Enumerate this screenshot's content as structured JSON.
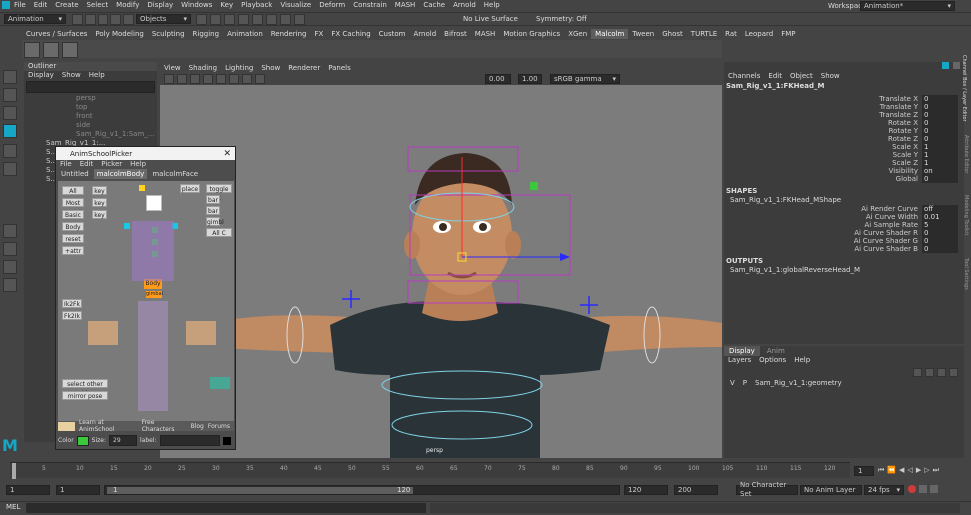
{
  "menu": {
    "items": [
      "File",
      "Edit",
      "Create",
      "Select",
      "Modify",
      "Display",
      "Windows",
      "Key",
      "Playback",
      "Visualize",
      "Deform",
      "Constrain",
      "MASH",
      "Cache",
      "Arnold",
      "Help"
    ],
    "workspace_label": "Workspace :",
    "workspace_value": "Animation*"
  },
  "status_line": {
    "mode": "Animation",
    "objects_label": "Objects",
    "live_surface": "No Live Surface",
    "symmetry": "Symmetry: Off"
  },
  "shelf_tabs": [
    "Curves / Surfaces",
    "Poly Modeling",
    "Sculpting",
    "Rigging",
    "Animation",
    "Rendering",
    "FX",
    "FX Caching",
    "Custom",
    "Arnold",
    "Bifrost",
    "MASH",
    "Motion Graphics",
    "XGen",
    "Malcolm",
    "Tween",
    "Ghost",
    "TURTLE",
    "Rat",
    "Leopard",
    "FMP"
  ],
  "shelf_active": "Malcolm",
  "outliner": {
    "title": "Outliner",
    "menus": [
      "Display",
      "Show",
      "Help"
    ],
    "items": [
      "persp",
      "top",
      "front",
      "side",
      "Sam_Rig_v1_1:Sam_...",
      "Sam_Rig_v1_1:...",
      "S...",
      "S...",
      "S...",
      "S..."
    ]
  },
  "viewport": {
    "menus": [
      "View",
      "Shading",
      "Lighting",
      "Show",
      "Renderer",
      "Panels"
    ],
    "field1": "0.00",
    "field2": "1.00",
    "colorspace": "sRGB gamma",
    "camera_label": "persp"
  },
  "picker": {
    "title": "AnimSchoolPicker",
    "menus": [
      "File",
      "Edit",
      "Picker",
      "Help"
    ],
    "tabs": [
      "Untitled",
      "malcolmBody",
      "malcolmFace"
    ],
    "active_tab": "malcolmBody",
    "left_buttons": [
      "All",
      "Most",
      "Basic",
      "Body",
      "reset",
      "+attr"
    ],
    "key_buttons": [
      "key",
      "key",
      "key"
    ],
    "right_buttons": [
      "place",
      "toggle C",
      "bar",
      "bar",
      "gimbl",
      "All C"
    ],
    "body_label": "Body",
    "gimbal_label": "gimbal",
    "ik_labels": [
      "Ik2Fk",
      "Fk2Ik"
    ],
    "select_other": "select other side",
    "mirror_pose": "mirror pose",
    "footer_links": [
      "Learn at AnimSchool",
      "Free Characters",
      "Blog",
      "Forums"
    ],
    "color_label": "Color",
    "size_label": "Size:",
    "size_value": "29",
    "label_label": "label:"
  },
  "channel_box": {
    "menus": [
      "Channels",
      "Edit",
      "Object",
      "Show"
    ],
    "node": "Sam_Rig_v1_1:FKHead_M",
    "channels": [
      {
        "name": "Translate X",
        "value": "0"
      },
      {
        "name": "Translate Y",
        "value": "0"
      },
      {
        "name": "Translate Z",
        "value": "0"
      },
      {
        "name": "Rotate X",
        "value": "0"
      },
      {
        "name": "Rotate Y",
        "value": "0"
      },
      {
        "name": "Rotate Z",
        "value": "0"
      },
      {
        "name": "Scale X",
        "value": "1"
      },
      {
        "name": "Scale Y",
        "value": "1"
      },
      {
        "name": "Scale Z",
        "value": "1"
      },
      {
        "name": "Visibility",
        "value": "on"
      },
      {
        "name": "Global",
        "value": "0"
      }
    ],
    "shapes_label": "SHAPES",
    "shape_node": "Sam_Rig_v1_1:FKHead_MShape",
    "shape_channels": [
      {
        "name": "Ai Render Curve",
        "value": "off"
      },
      {
        "name": "Ai Curve Width",
        "value": "0.01"
      },
      {
        "name": "Ai Sample Rate",
        "value": "5"
      },
      {
        "name": "Ai Curve Shader R",
        "value": "0"
      },
      {
        "name": "Ai Curve Shader G",
        "value": "0"
      },
      {
        "name": "Ai Curve Shader B",
        "value": "0"
      }
    ],
    "outputs_label": "OUTPUTS",
    "output_node": "Sam_Rig_v1_1:globalReverseHead_M"
  },
  "layer_editor": {
    "tabs": [
      "Display",
      "Anim"
    ],
    "menus": [
      "Layers",
      "Options",
      "Help"
    ],
    "layer_v": "V",
    "layer_p": "P",
    "layer_name": "Sam_Rig_v1_1:geometry"
  },
  "side_tabs": [
    "Channel Box / Layer Editor",
    "Attribute Editor",
    "Modeling Toolkit",
    "Tool Settings"
  ],
  "timeline": {
    "ticks": [
      "5",
      "10",
      "15",
      "20",
      "25",
      "30",
      "35",
      "40",
      "45",
      "50",
      "55",
      "60",
      "65",
      "70",
      "75",
      "80",
      "85",
      "90",
      "95",
      "100",
      "105",
      "110",
      "115",
      "120"
    ],
    "current_frame": "1"
  },
  "range": {
    "start": "1",
    "start2": "1",
    "slider_start": "1",
    "slider_end": "120",
    "end": "120",
    "end2": "200",
    "character_set": "No Character Set",
    "anim_layer": "No Anim Layer",
    "fps": "24 fps"
  },
  "command_line": {
    "label": "MEL"
  },
  "colors": {
    "maya_blue": "#16a7c7",
    "manip_magenta": "#b83bbf",
    "green_ctrl": "#3cc83c",
    "picker_orange": "#ff9a1a"
  }
}
